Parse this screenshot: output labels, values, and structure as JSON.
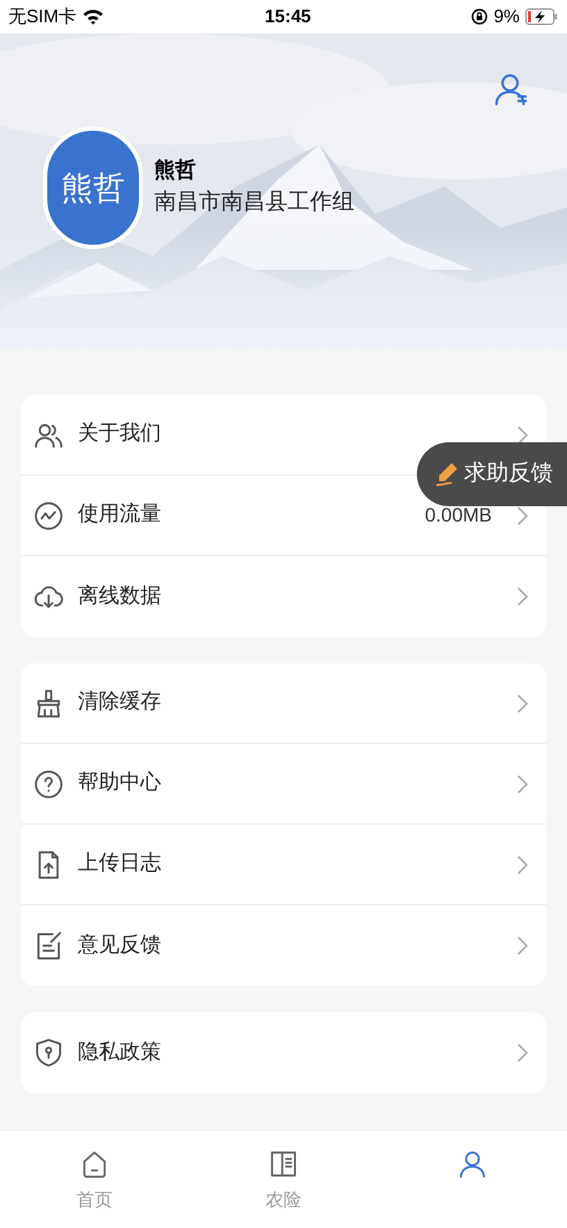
{
  "status_bar": {
    "carrier": "无SIM卡",
    "time": "15:45",
    "battery": "9%"
  },
  "profile": {
    "avatar_text": "熊哲",
    "name": "熊哲",
    "group": "南昌市南昌县工作组"
  },
  "menu_groups": [
    [
      {
        "label": "关于我们"
      },
      {
        "label": "使用流量",
        "value": "0.00MB"
      },
      {
        "label": "离线数据"
      }
    ],
    [
      {
        "label": "清除缓存"
      },
      {
        "label": "帮助中心"
      },
      {
        "label": "上传日志"
      },
      {
        "label": "意见反馈"
      }
    ],
    [
      {
        "label": "隐私政策"
      }
    ]
  ],
  "float_button": {
    "label": "求助反馈"
  },
  "tab_bar": [
    {
      "label": "首页",
      "selected": false
    },
    {
      "label": "农险",
      "selected": false
    },
    {
      "selected": true
    }
  ]
}
